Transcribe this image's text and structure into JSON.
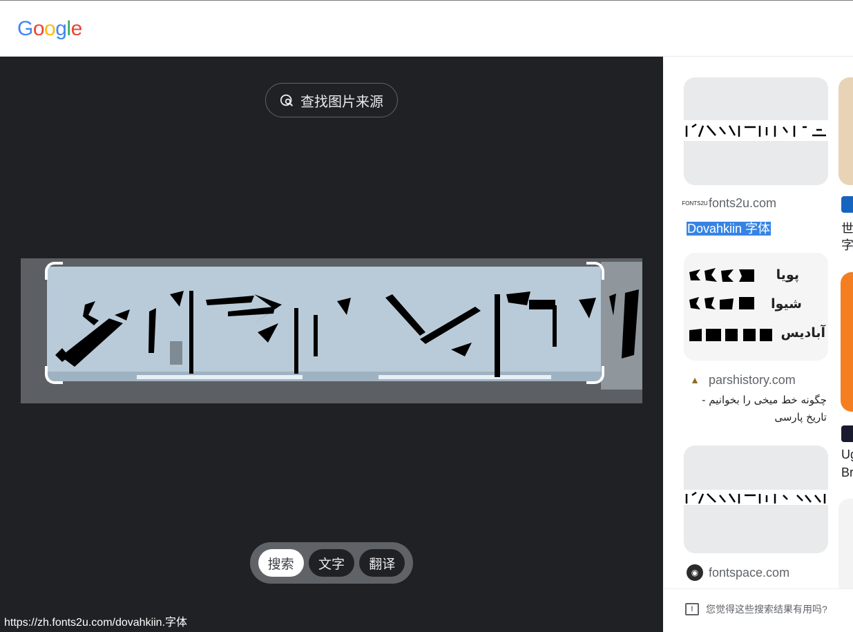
{
  "header": {
    "logo_letters": [
      {
        "ch": "G",
        "color": "#4285F4"
      },
      {
        "ch": "o",
        "color": "#EA4335"
      },
      {
        "ch": "o",
        "color": "#FBBC05"
      },
      {
        "ch": "g",
        "color": "#4285F4"
      },
      {
        "ch": "l",
        "color": "#34A853"
      },
      {
        "ch": "e",
        "color": "#EA4335"
      }
    ]
  },
  "viewer": {
    "find_source_label": "查找图片来源",
    "modes": [
      {
        "label": "搜索",
        "active": true
      },
      {
        "label": "文字",
        "active": false
      },
      {
        "label": "翻译",
        "active": false
      }
    ],
    "status_url": "https://zh.fonts2u.com/dovahkiin.字体"
  },
  "results": {
    "r1": {
      "site": "fonts2u.com",
      "title": "Dovahkiin 字体",
      "favicon": "fonts2u-icon"
    },
    "r2": {
      "site": "parshistory.com",
      "title_line1": "چگونه خط میخی را بخوانیم -",
      "title_line2": "تاریخ پارسی",
      "favicon": "parshistory-icon",
      "thumb_rows": [
        "پویا",
        "شیوا",
        "آبادیس"
      ]
    },
    "r3": {
      "site": "fontspace.com",
      "favicon": "fontspace-icon"
    },
    "peek": {
      "line1": "世",
      "line2": "字",
      "line3": "Ug",
      "line4": "Br"
    },
    "feedback_text": "您觉得这些搜索结果有用吗?"
  },
  "colors": {
    "dark_bg": "#202124",
    "highlight": "#3584e4"
  }
}
